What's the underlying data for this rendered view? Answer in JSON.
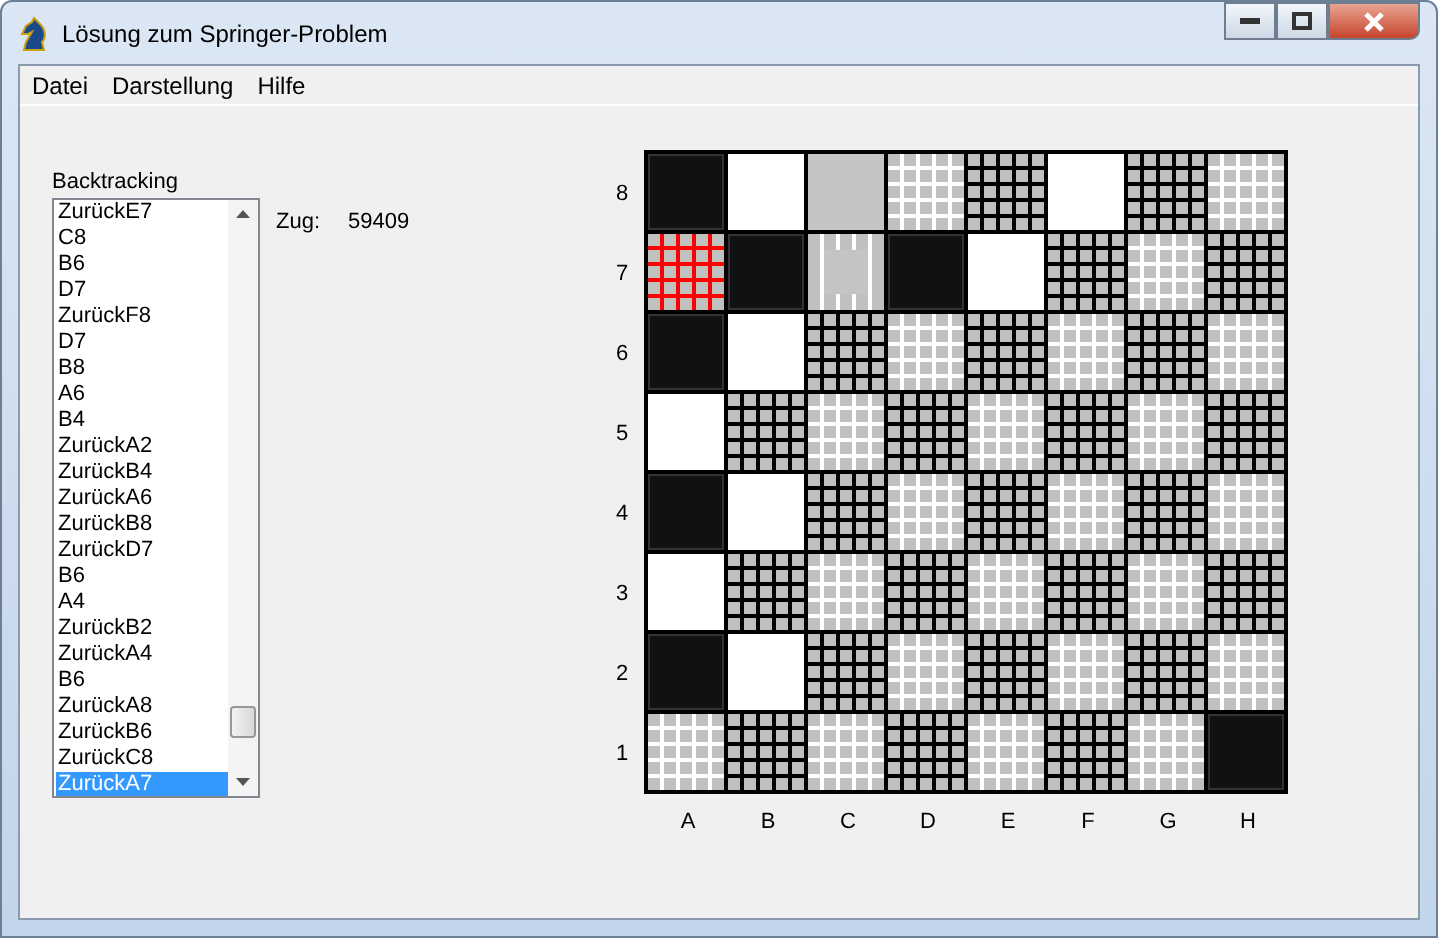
{
  "window": {
    "title": "Lösung zum Springer-Problem"
  },
  "menu": [
    "Datei",
    "Darstellung",
    "Hilfe"
  ],
  "backtracking": {
    "label": "Backtracking",
    "items": [
      {
        "text": "ZurückE7",
        "selected": false
      },
      {
        "text": "C8",
        "selected": false
      },
      {
        "text": "B6",
        "selected": false
      },
      {
        "text": "D7",
        "selected": false
      },
      {
        "text": "ZurückF8",
        "selected": false
      },
      {
        "text": "D7",
        "selected": false
      },
      {
        "text": "B8",
        "selected": false
      },
      {
        "text": "A6",
        "selected": false
      },
      {
        "text": "B4",
        "selected": false
      },
      {
        "text": "ZurückA2",
        "selected": false
      },
      {
        "text": "ZurückB4",
        "selected": false
      },
      {
        "text": "ZurückA6",
        "selected": false
      },
      {
        "text": "ZurückB8",
        "selected": false
      },
      {
        "text": "ZurückD7",
        "selected": false
      },
      {
        "text": "B6",
        "selected": false
      },
      {
        "text": "A4",
        "selected": false
      },
      {
        "text": "ZurückB2",
        "selected": false
      },
      {
        "text": "ZurückA4",
        "selected": false
      },
      {
        "text": "B6",
        "selected": false
      },
      {
        "text": "ZurückA8",
        "selected": false
      },
      {
        "text": "ZurückB6",
        "selected": false
      },
      {
        "text": "ZurückC8",
        "selected": false
      },
      {
        "text": "ZurückA7",
        "selected": true
      }
    ]
  },
  "move": {
    "label": "Zug:",
    "value": "59409"
  },
  "board": {
    "ranks": [
      {
        "label": "8",
        "squares": [
          {
            "kind": "black"
          },
          {
            "kind": "white"
          },
          {
            "kind": "plain"
          },
          {
            "kind": "light"
          },
          {
            "kind": "dark"
          },
          {
            "kind": "white"
          },
          {
            "kind": "dark"
          },
          {
            "kind": "light"
          }
        ]
      },
      {
        "label": "7",
        "squares": [
          {
            "kind": "red"
          },
          {
            "kind": "black"
          },
          {
            "kind": "framed"
          },
          {
            "kind": "black"
          },
          {
            "kind": "white"
          },
          {
            "kind": "dark"
          },
          {
            "kind": "light"
          },
          {
            "kind": "dark"
          }
        ]
      },
      {
        "label": "6",
        "squares": [
          {
            "kind": "black"
          },
          {
            "kind": "white"
          },
          {
            "kind": "dark"
          },
          {
            "kind": "light"
          },
          {
            "kind": "dark"
          },
          {
            "kind": "light"
          },
          {
            "kind": "dark"
          },
          {
            "kind": "light"
          }
        ]
      },
      {
        "label": "5",
        "squares": [
          {
            "kind": "white"
          },
          {
            "kind": "dark"
          },
          {
            "kind": "light"
          },
          {
            "kind": "dark"
          },
          {
            "kind": "light"
          },
          {
            "kind": "dark"
          },
          {
            "kind": "light"
          },
          {
            "kind": "dark"
          }
        ]
      },
      {
        "label": "4",
        "squares": [
          {
            "kind": "black"
          },
          {
            "kind": "white"
          },
          {
            "kind": "dark"
          },
          {
            "kind": "light"
          },
          {
            "kind": "dark"
          },
          {
            "kind": "light"
          },
          {
            "kind": "dark"
          },
          {
            "kind": "light"
          }
        ]
      },
      {
        "label": "3",
        "squares": [
          {
            "kind": "white"
          },
          {
            "kind": "dark"
          },
          {
            "kind": "light"
          },
          {
            "kind": "dark"
          },
          {
            "kind": "light"
          },
          {
            "kind": "dark"
          },
          {
            "kind": "light"
          },
          {
            "kind": "dark"
          }
        ]
      },
      {
        "label": "2",
        "squares": [
          {
            "kind": "black"
          },
          {
            "kind": "white"
          },
          {
            "kind": "dark"
          },
          {
            "kind": "light"
          },
          {
            "kind": "dark"
          },
          {
            "kind": "light"
          },
          {
            "kind": "dark"
          },
          {
            "kind": "light"
          }
        ]
      },
      {
        "label": "1",
        "squares": [
          {
            "kind": "light"
          },
          {
            "kind": "dark"
          },
          {
            "kind": "light"
          },
          {
            "kind": "dark"
          },
          {
            "kind": "light"
          },
          {
            "kind": "dark"
          },
          {
            "kind": "light"
          },
          {
            "kind": "black"
          }
        ]
      }
    ],
    "files": [
      "A",
      "B",
      "C",
      "D",
      "E",
      "F",
      "G",
      "H"
    ]
  }
}
